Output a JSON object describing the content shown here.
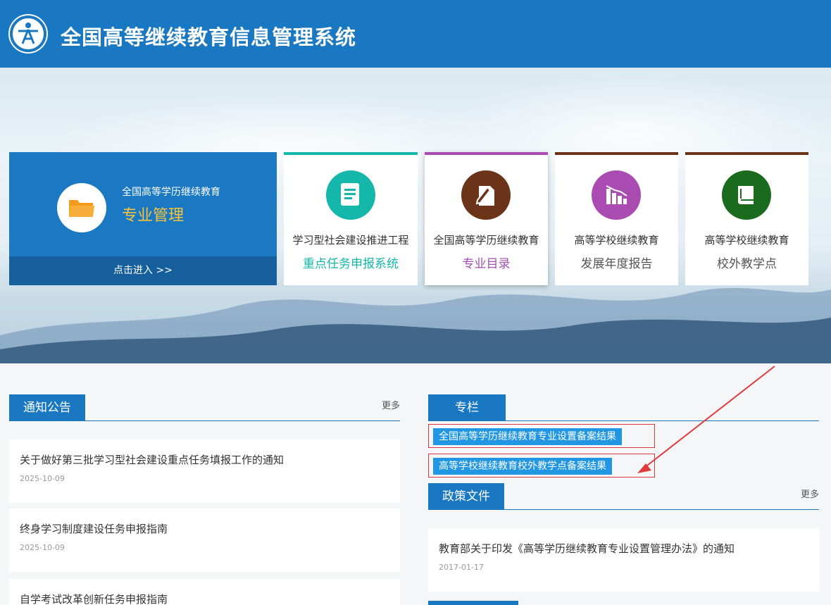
{
  "header": {
    "title": "全国高等继续教育信息管理系统"
  },
  "main_card": {
    "subtitle": "全国高等学历继续教育",
    "title": "专业管理",
    "enter_label": "点击进入 >>"
  },
  "cards": [
    {
      "line1": "学习型社会建设推进工程",
      "line2": "重点任务申报系统",
      "color": "#14b7a9",
      "line2_color": "#14b7a9",
      "icon": "document-icon"
    },
    {
      "line1": "全国高等学历继续教育",
      "line2": "专业目录",
      "color": "#6b3419",
      "line2_color": "#a04fb0",
      "icon": "edit-document-icon"
    },
    {
      "line1": "高等学校继续教育",
      "line2": "发展年度报告",
      "color": "#a94bb1",
      "line2_color": "#555555",
      "icon": "bar-chart-icon"
    },
    {
      "line1": "高等学校继续教育",
      "line2": "校外教学点",
      "color": "#1a6b1e",
      "line2_color": "#555555",
      "icon": "book-icon"
    }
  ],
  "notices": {
    "heading": "通知公告",
    "more": "更多",
    "items": [
      {
        "title": "关于做好第三批学习型社会建设重点任务填报工作的通知",
        "date": "2025-10-09"
      },
      {
        "title": "终身学习制度建设任务申报指南",
        "date": "2025-10-09"
      },
      {
        "title": "自学考试改革创新任务申报指南",
        "date": ""
      }
    ]
  },
  "column": {
    "heading": "专栏",
    "links": [
      "全国高等学历继续教育专业设置备案结果",
      "高等学校继续教育校外教学点备案结果"
    ]
  },
  "policy": {
    "heading": "政策文件",
    "more": "更多",
    "items": [
      {
        "title": "教育部关于印发《高等学历继续教育专业设置管理办法》的通知",
        "date": "2017-01-17"
      }
    ]
  },
  "colors": {
    "brand_blue": "#1a78c2",
    "highlight_red": "#d9363e",
    "gold": "#f7c43a"
  }
}
